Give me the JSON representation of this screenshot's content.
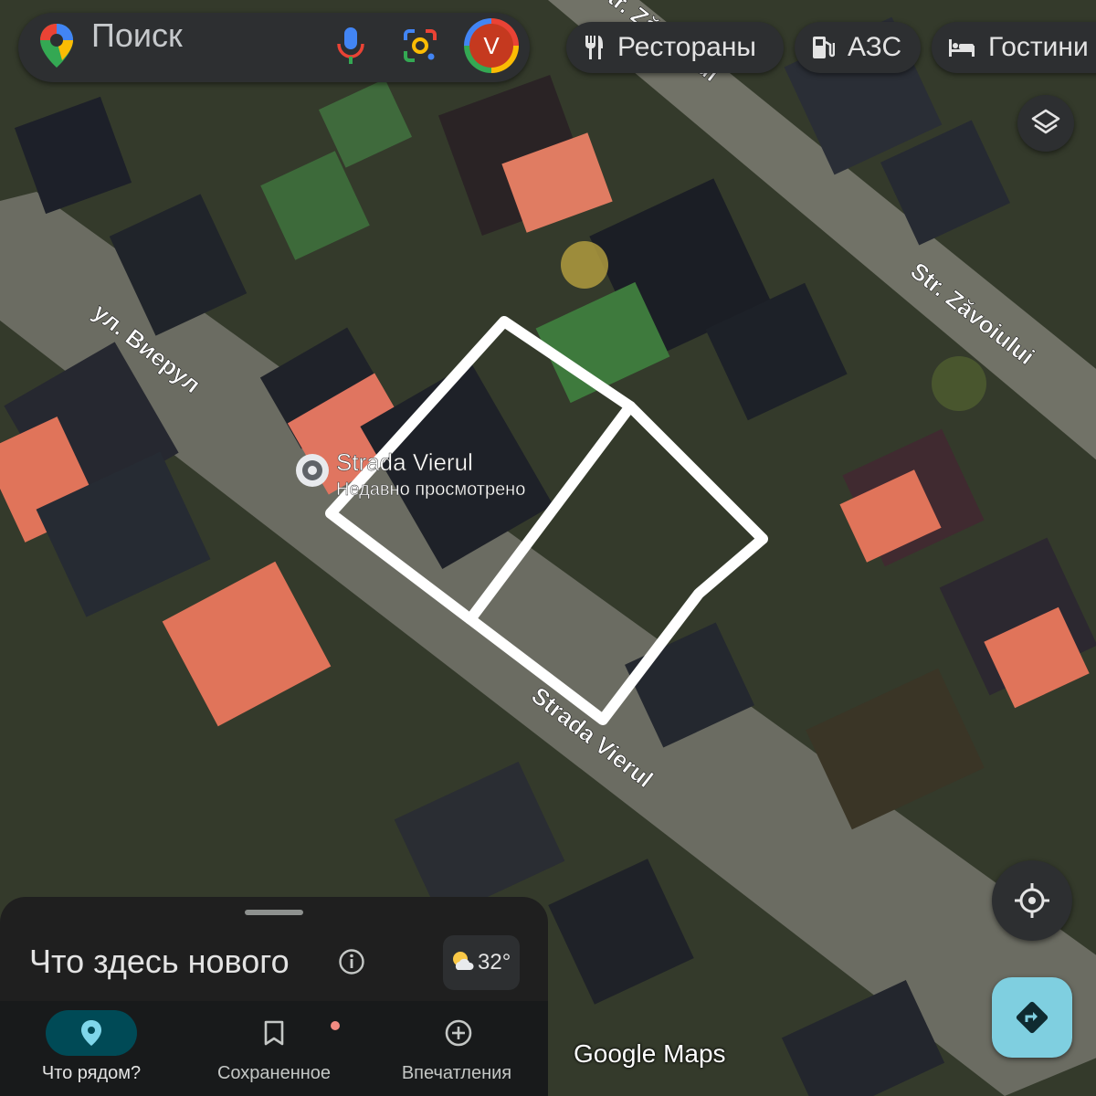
{
  "search": {
    "placeholder": "Поиск"
  },
  "account": {
    "initial": "V"
  },
  "chips": [
    {
      "label": "Рестораны",
      "icon": "restaurant-icon"
    },
    {
      "label": "АЗС",
      "icon": "gas-station-icon"
    },
    {
      "label": "Гостини",
      "icon": "hotel-icon"
    }
  ],
  "map": {
    "streets": [
      {
        "label": "ул. Виерул"
      },
      {
        "label": "Str. Zăvoiului"
      },
      {
        "label": "Str. Zăvoiului"
      },
      {
        "label": "Strada Vierul"
      }
    ],
    "place": {
      "name": "Strada Vierul",
      "subtitle": "Недавно просмотрено"
    },
    "attribution": "Google Maps"
  },
  "sheet": {
    "title": "Что здесь нового",
    "weather": {
      "temp": "32°",
      "icon": "partly-sunny-icon"
    }
  },
  "nav": [
    {
      "label": "Что рядом?",
      "icon": "location-pin-icon",
      "active": true
    },
    {
      "label": "Сохраненное",
      "icon": "bookmark-icon",
      "active": false,
      "badge": true
    },
    {
      "label": "Впечатления",
      "icon": "add-circle-icon",
      "active": false
    }
  ],
  "colors": {
    "sheet_bg": "#1f1f1f",
    "nav_active": "#004a56",
    "directions": "#7fcfe0",
    "roof_red": "#e0745a",
    "outline": "#ffffff"
  }
}
